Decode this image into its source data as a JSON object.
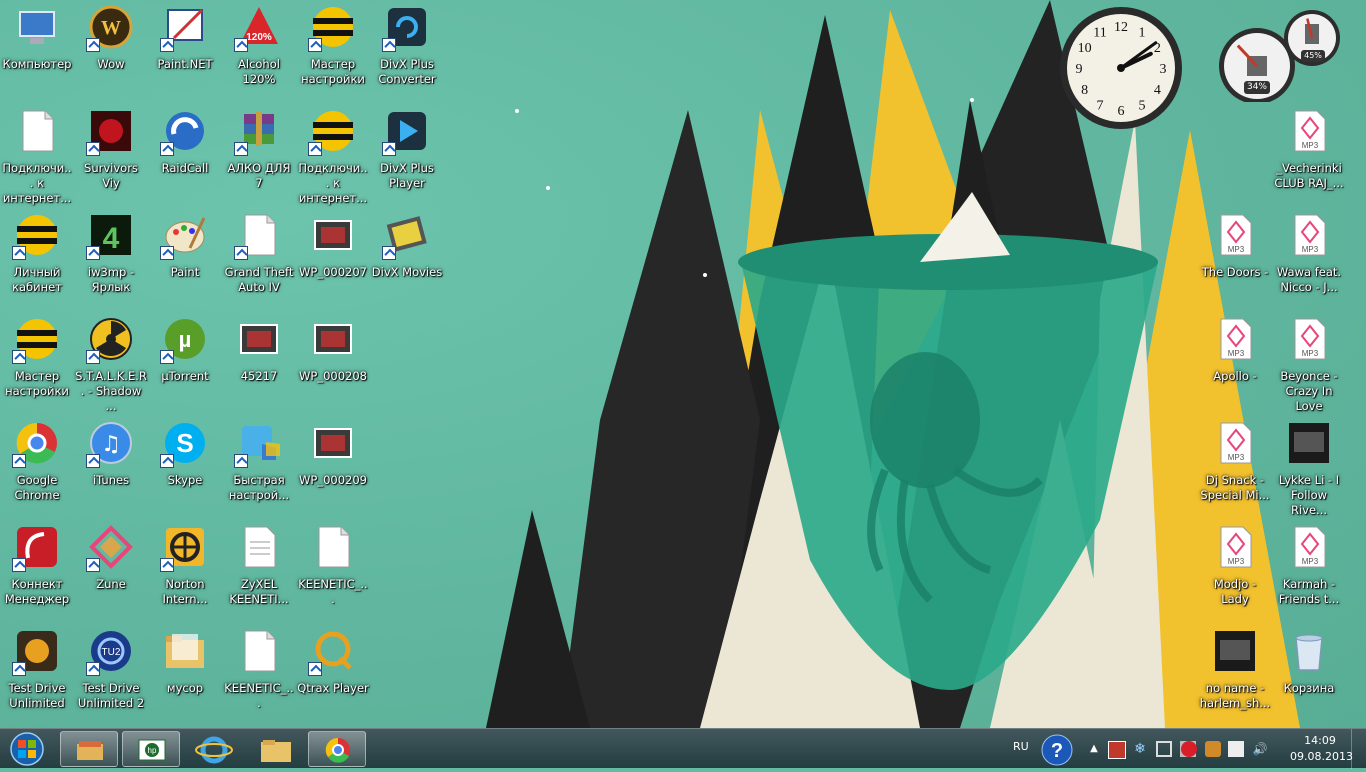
{
  "desktop": {
    "icons": [
      {
        "label": "Компьютер",
        "glyph": "computer-icon"
      },
      {
        "label": "Wow",
        "glyph": "wow-icon"
      },
      {
        "label": "Paint.NET",
        "glyph": "paintnet-icon"
      },
      {
        "label": "Alcohol 120%",
        "glyph": "alcohol-icon"
      },
      {
        "label": "Мастер настройки",
        "glyph": "beeline-icon"
      },
      {
        "label": "DivX Plus Converter",
        "glyph": "divx-converter-icon"
      },
      {
        "label": "Подключи... к интернет...",
        "glyph": "document-icon"
      },
      {
        "label": "Survivors Viy",
        "glyph": "game-icon"
      },
      {
        "label": "RaidCall",
        "glyph": "raidcall-icon"
      },
      {
        "label": "АЛКО ДЛЯ 7",
        "glyph": "winrar-icon"
      },
      {
        "label": "Подключи... к интернет...",
        "glyph": "beeline-icon"
      },
      {
        "label": "DivX Plus Player",
        "glyph": "divx-player-icon"
      },
      {
        "label": "Личный кабинет",
        "glyph": "beeline-icon"
      },
      {
        "label": "iw3mp - Ярлык",
        "glyph": "cod4-icon"
      },
      {
        "label": "Paint",
        "glyph": "paint-icon"
      },
      {
        "label": "Grand Theft Auto IV",
        "glyph": "document-icon"
      },
      {
        "label": "WP_000207",
        "glyph": "photo-icon"
      },
      {
        "label": "DivX Movies",
        "glyph": "divx-movies-icon"
      },
      {
        "label": "Мастер настройки",
        "glyph": "beeline-icon"
      },
      {
        "label": "S.T.A.L.K.E.R. - Shadow ...",
        "glyph": "stalker-icon"
      },
      {
        "label": "µTorrent",
        "glyph": "utorrent-icon"
      },
      {
        "label": "45217",
        "glyph": "photo-icon"
      },
      {
        "label": "WP_000208",
        "glyph": "photo-icon"
      },
      {
        "label": "Google Chrome",
        "glyph": "chrome-icon"
      },
      {
        "label": "iTunes",
        "glyph": "itunes-icon"
      },
      {
        "label": "Skype",
        "glyph": "skype-icon"
      },
      {
        "label": "Быстрая настрой...",
        "glyph": "quicksetup-icon"
      },
      {
        "label": "WP_000209",
        "glyph": "photo-icon"
      },
      {
        "label": "Коннект Менеджер",
        "glyph": "connect-manager-icon"
      },
      {
        "label": "Zune",
        "glyph": "zune-icon"
      },
      {
        "label": "Norton Intern...",
        "glyph": "norton-icon"
      },
      {
        "label": "ZyXEL KEENETI...",
        "glyph": "text-document-icon"
      },
      {
        "label": "KEENETIC_...",
        "glyph": "document-icon"
      },
      {
        "label": "Test Drive Unlimited",
        "glyph": "tdu-icon"
      },
      {
        "label": "Test Drive Unlimited 2",
        "glyph": "tdu2-icon"
      },
      {
        "label": "мусор",
        "glyph": "folder-icon"
      },
      {
        "label": "KEENETIC_...",
        "glyph": "document-icon"
      },
      {
        "label": "Qtrax Player",
        "glyph": "qtrax-icon"
      },
      {
        "label": "_Vecherinki CLUB RAJ_...",
        "glyph": "mp3-icon"
      },
      {
        "label": "The Doors -",
        "glyph": "mp3-icon"
      },
      {
        "label": "Wawa feat. Nicco - J...",
        "glyph": "mp3-icon"
      },
      {
        "label": "Apollo -",
        "glyph": "mp3-icon"
      },
      {
        "label": "Beyonce - Crazy In Love",
        "glyph": "mp3-icon"
      },
      {
        "label": "Dj Snack - Special Mi...",
        "glyph": "mp3-icon"
      },
      {
        "label": "Lykke Li - I Follow Rive...",
        "glyph": "album-art-icon"
      },
      {
        "label": "Modjo - Lady",
        "glyph": "mp3-icon"
      },
      {
        "label": "Karmah - Friends t...",
        "glyph": "mp3-icon"
      },
      {
        "label": "no name - harlem_sh...",
        "glyph": "album-art-icon"
      },
      {
        "label": "Корзина",
        "glyph": "recycle-bin-icon"
      }
    ]
  },
  "gadgets": {
    "clock": {
      "numerals": [
        "12",
        "1",
        "2",
        "3",
        "4",
        "5",
        "6",
        "7",
        "8",
        "9",
        "10",
        "11"
      ],
      "hour": 14,
      "minute": 9
    },
    "cpu_meter": {
      "cpu_percent": "34%",
      "memory_percent": "45%",
      "cpu_value": 34,
      "memory_value": 45
    }
  },
  "taskbar": {
    "pinned": [
      "windows-explorer",
      "hp",
      "internet-explorer",
      "libraries",
      "google-chrome"
    ],
    "language": "RU",
    "time": "14:09",
    "date": "09.08.2013"
  },
  "colors": {
    "wallpaper_teal": "#63bba3",
    "yellow": "#f2c12e",
    "black": "#1e1f1e",
    "cream": "#ece6d4",
    "jelly": "#2aa88a"
  }
}
